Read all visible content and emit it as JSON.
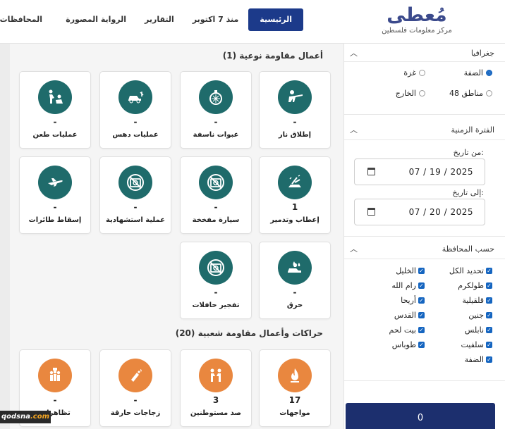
{
  "header": {
    "logo_title": "مُعطى",
    "logo_subtitle": "مركز معلومات فلسطين",
    "nav": [
      "الرئيسية",
      "منذ 7 اكتوبر",
      "التقارير",
      "الرواية المصورة"
    ],
    "nav_clipped": "المحافظات",
    "brand_color": "#1c3a8a"
  },
  "sidebar": {
    "geo": {
      "title": "جغرافيا",
      "options": [
        "الضفة",
        "غزة",
        "مناطق 48",
        "الخارج"
      ],
      "selected": "الضفة"
    },
    "period": {
      "title": "الفترة الزمنية",
      "from_label": "من تاريخ:",
      "from_value": "07 / 19 / 2025",
      "to_label": "إلى تاريخ:",
      "to_value": "07 / 20 / 2025"
    },
    "governorate": {
      "title": "حسب المحافظة",
      "right_col": [
        "تحديد الكل",
        "طولكرم",
        "قلقيلية",
        "جنين",
        "نابلس",
        "سلفيت",
        "الضفة"
      ],
      "left_col": [
        "الخليل",
        "رام الله",
        "أريحا",
        "القدس",
        "بيت لحم",
        "طوباس"
      ]
    },
    "counter": "0"
  },
  "main": {
    "qualitative_title": "أعمال مقاومة نوعية (1)",
    "qualitative_cards": [
      {
        "label": "إطلاق نار",
        "count": "-",
        "icon": "gunman-icon"
      },
      {
        "label": "عبوات ناسفة",
        "count": "-",
        "icon": "grenade-icon"
      },
      {
        "label": "عمليات دهس",
        "count": "-",
        "icon": "car-ramming-icon"
      },
      {
        "label": "عمليات طعن",
        "count": "-",
        "icon": "stabbing-icon"
      },
      {
        "label": "إعطاب وتدمير",
        "count": "1",
        "icon": "sabotage-icon"
      },
      {
        "label": "سيارة مفخخة",
        "count": "-",
        "icon": "no-image-icon"
      },
      {
        "label": "عملية استشهادية",
        "count": "-",
        "icon": "no-image-icon"
      },
      {
        "label": "إسقاط طائرات",
        "count": "-",
        "icon": "plane-icon"
      },
      {
        "label": "حرق",
        "count": "-",
        "icon": "burning-car-icon"
      },
      {
        "label": "تفجير حافلات",
        "count": "-",
        "icon": "no-image-icon"
      }
    ],
    "popular_title": "حراكات وأعمال مقاومة شعبية (20)",
    "popular_cards": [
      {
        "label": "مواجهات",
        "count": "17",
        "icon": "fire-icon"
      },
      {
        "label": "صد مستوطنين",
        "count": "3",
        "icon": "fighters-icon"
      },
      {
        "label": "زجاجات حارقة",
        "count": "-",
        "icon": "molotov-icon"
      },
      {
        "label": "تظاهرات",
        "count": "-",
        "icon": "protest-icon"
      }
    ],
    "teal": "#1f6b6b",
    "orange": "#e9873f"
  },
  "watermark": {
    "pre": "qodsna",
    "post": ".com"
  }
}
